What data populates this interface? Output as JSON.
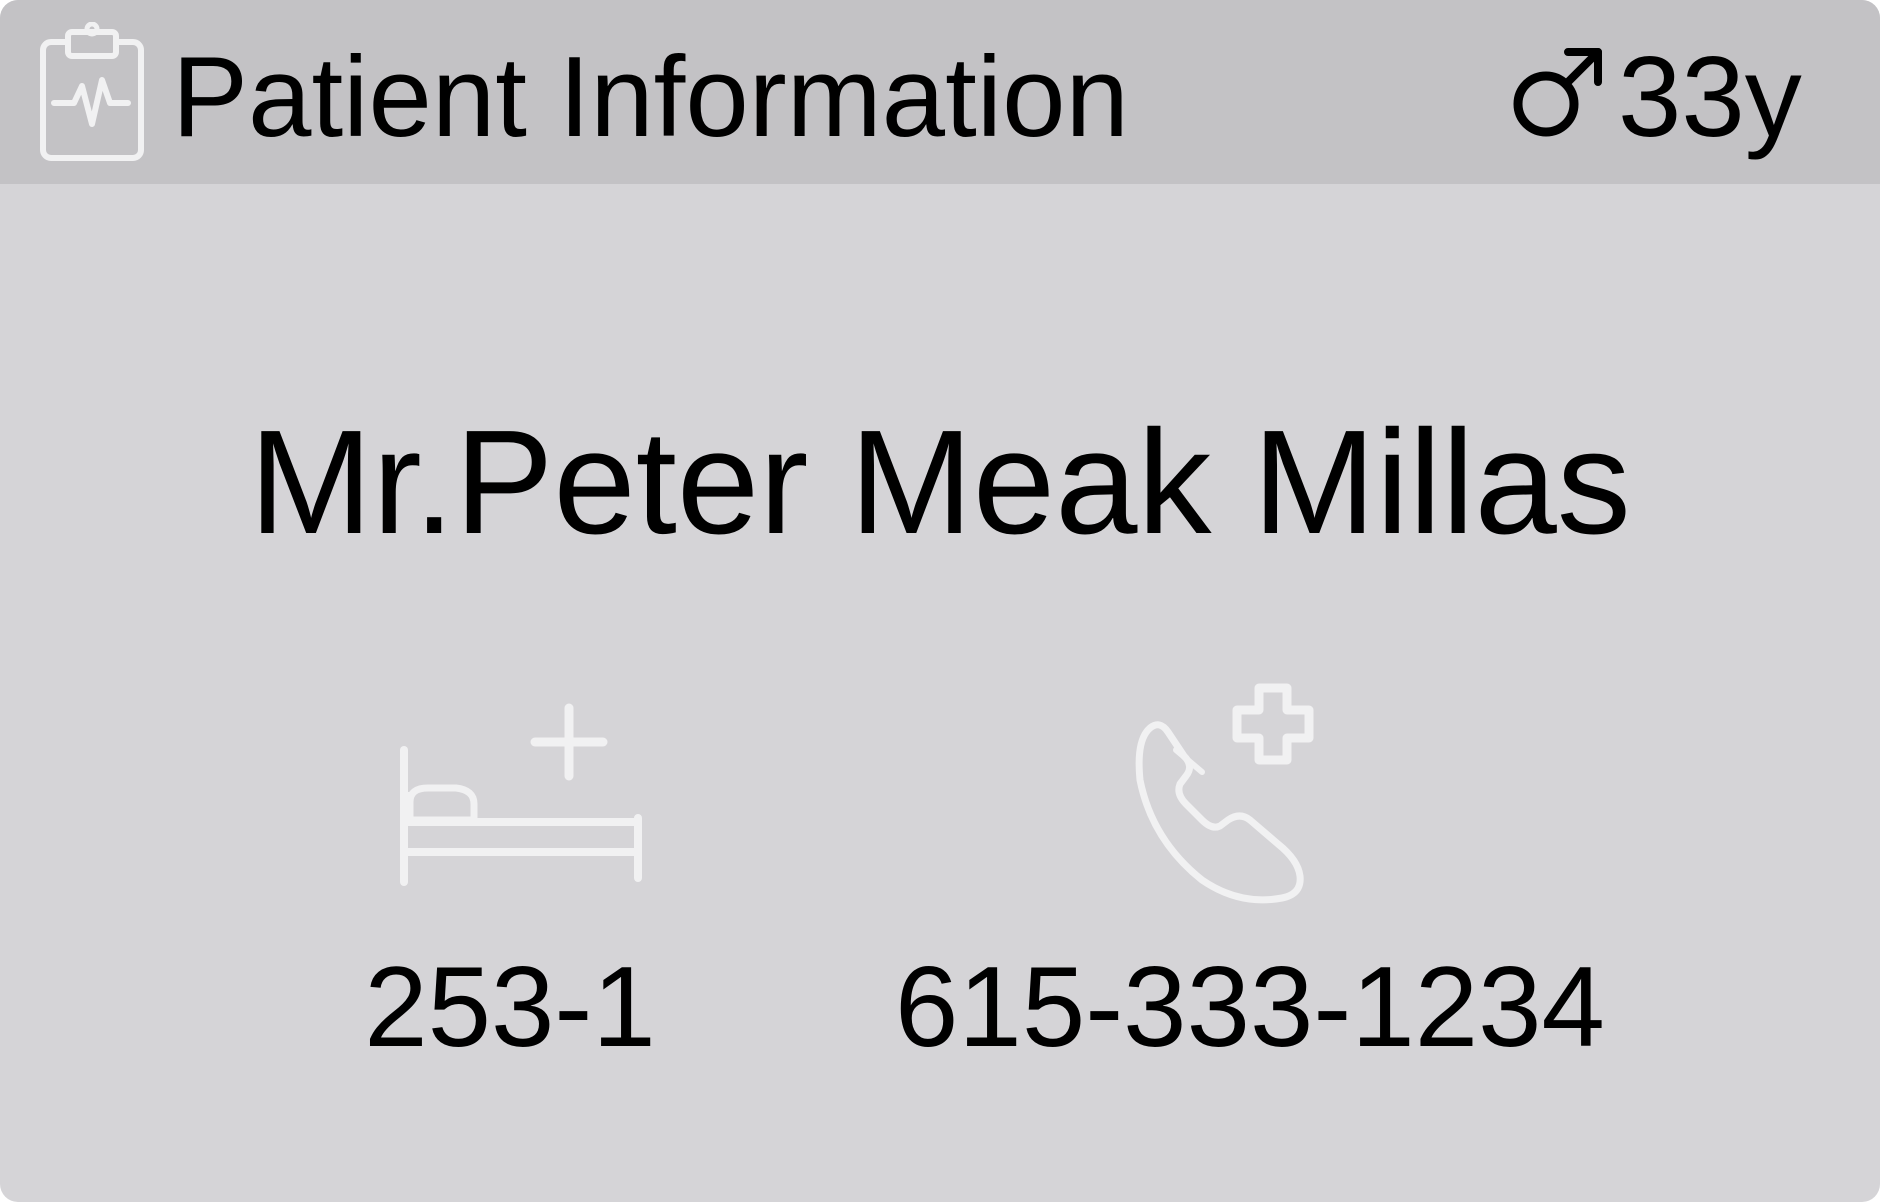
{
  "card": {
    "title": "Patient Information",
    "title_icon": "clipboard-pulse-icon",
    "gender_icon": "male-icon",
    "age": "33y",
    "patient_name": "Mr.Peter Meak Millas",
    "bed": {
      "icon": "hospital-bed-icon",
      "value": "253-1"
    },
    "contact": {
      "icon": "medical-phone-icon",
      "value": "615-333-1234"
    }
  },
  "colors": {
    "card_background": "#d5d4d7",
    "header_background": "#c3c2c5",
    "icon_light": "#f1f1f2",
    "text": "#000000"
  }
}
